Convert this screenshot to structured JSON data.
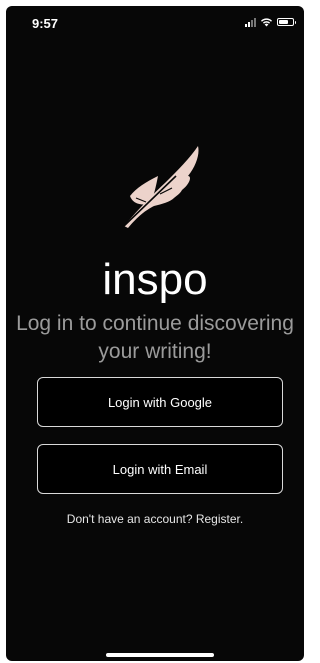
{
  "status_bar": {
    "time": "9:57",
    "icons": [
      "cellular-signal-icon",
      "wifi-icon",
      "battery-icon"
    ]
  },
  "logo": {
    "icon": "feather-icon",
    "color": "#ecd3cb"
  },
  "app_name": "inspo",
  "tagline": "Log in to continue discovering your writing!",
  "buttons": {
    "google": "Login with Google",
    "email": "Login with Email"
  },
  "register_text": "Don't have an account? Register.",
  "colors": {
    "background": "#070707",
    "text": "#ffffff",
    "tagline": "#9b9b9b",
    "button_border": "#d9d9d9"
  }
}
